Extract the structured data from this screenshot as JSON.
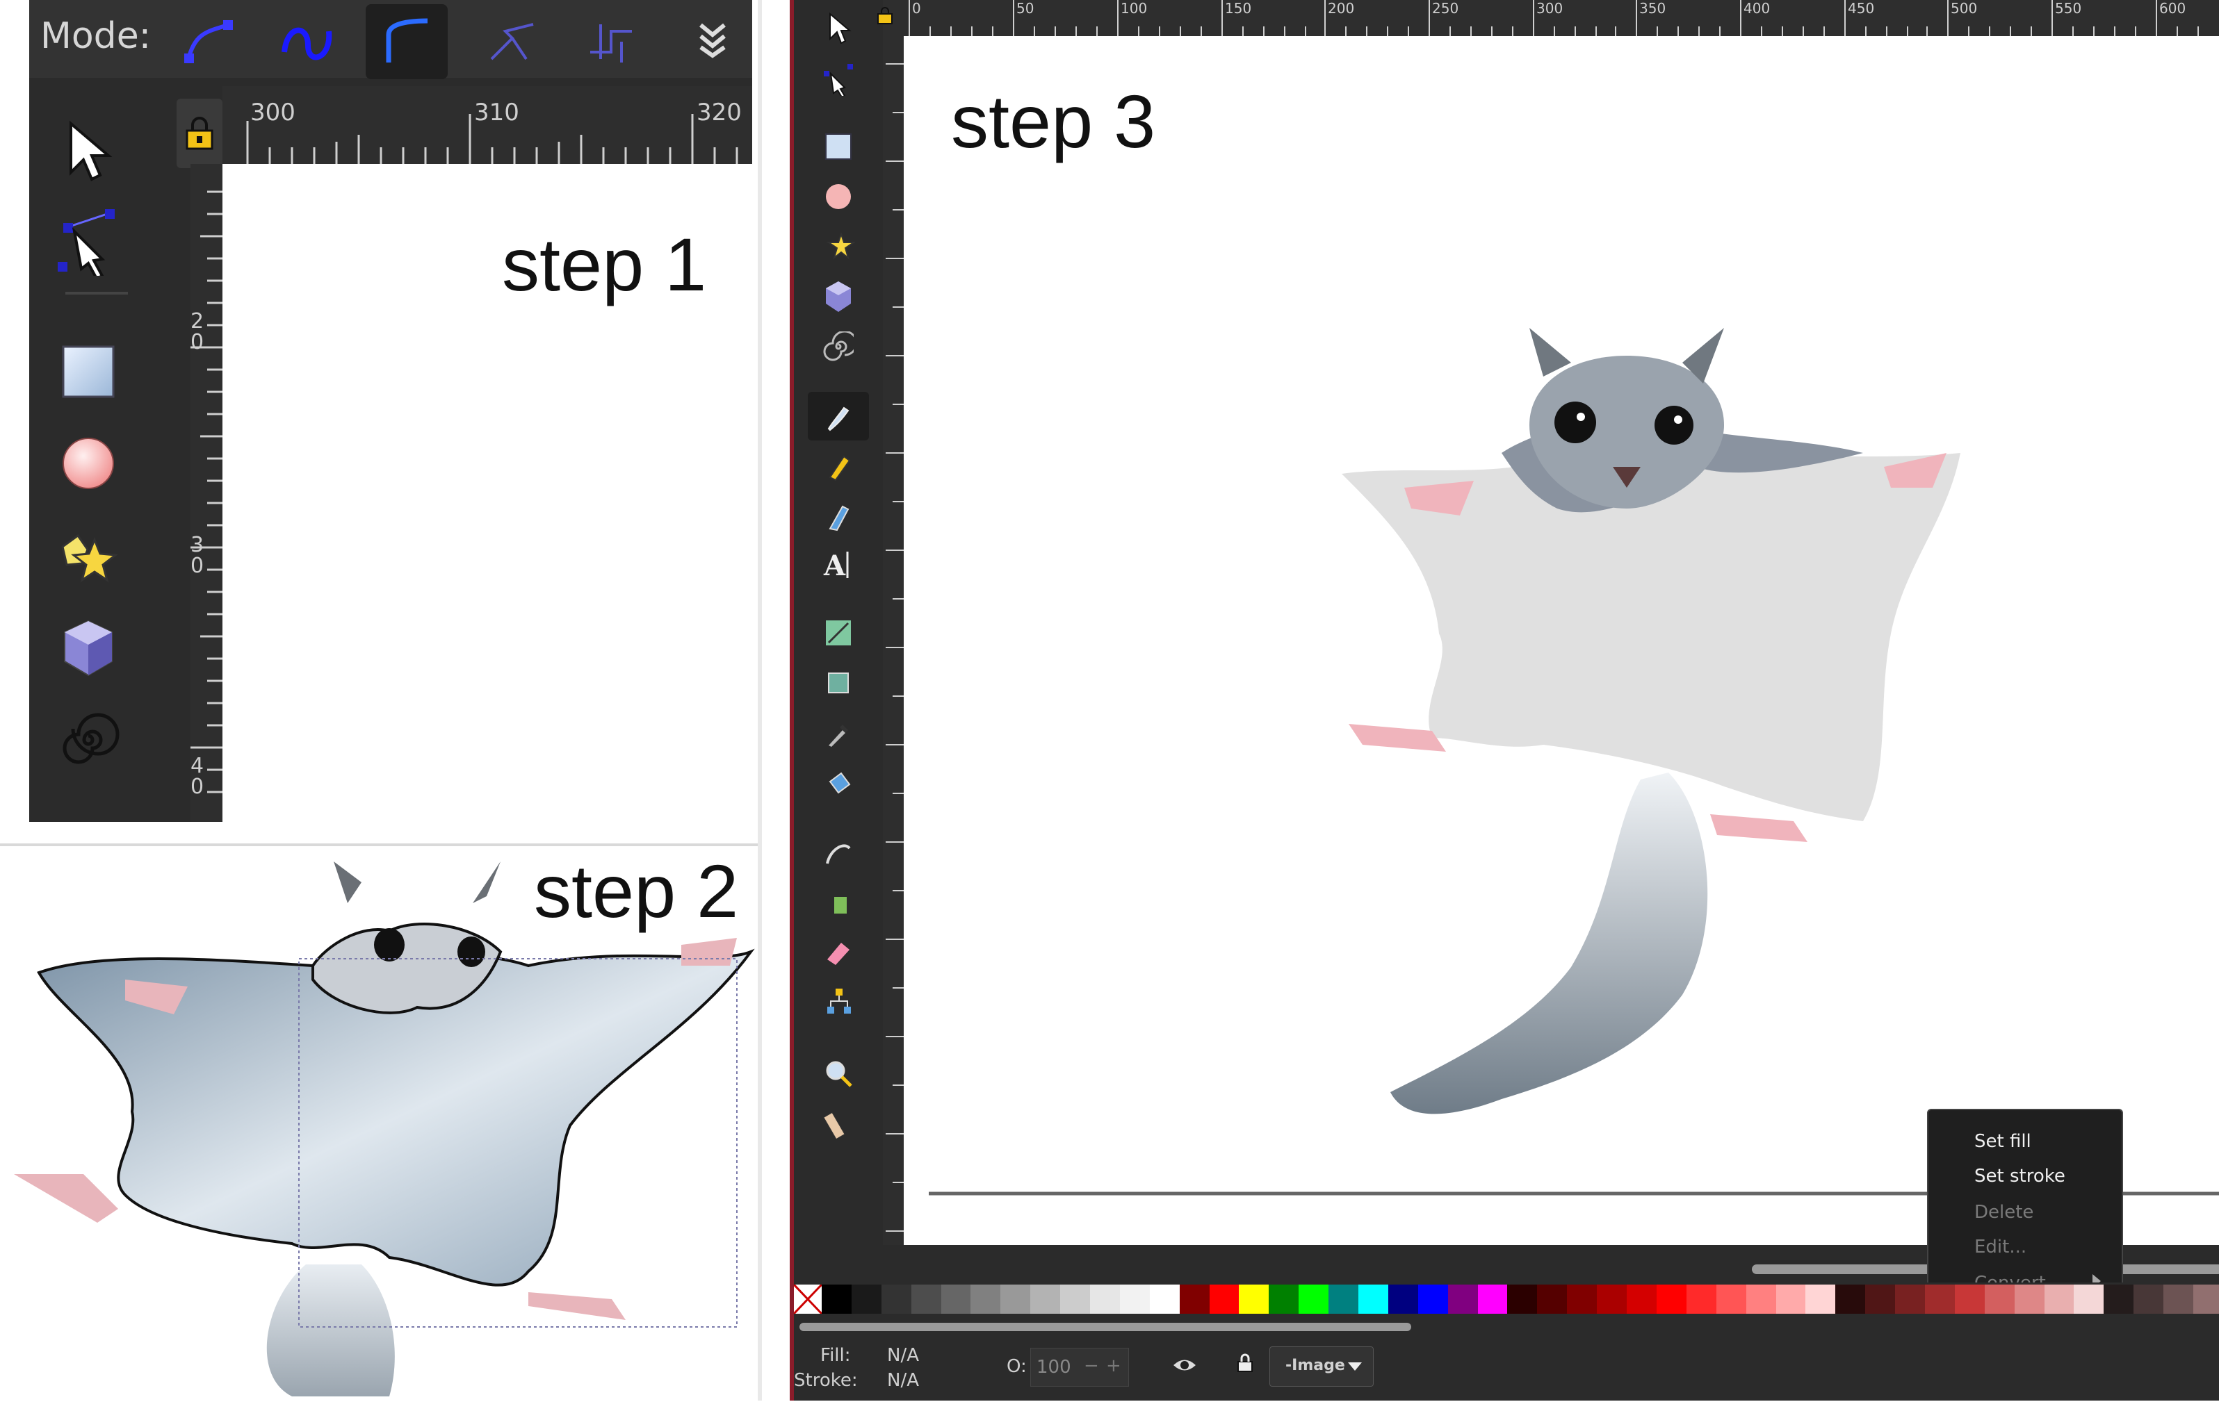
{
  "step_labels": {
    "step1": "step 1",
    "step2": "step 2",
    "step3": "step 3"
  },
  "panel1": {
    "mode_label": "Mode:",
    "mode_buttons": [
      "regular-bezier",
      "spiro",
      "bspline",
      "straight-segments",
      "paraxial-segments"
    ],
    "ruler_top": [
      "300",
      "310",
      "320"
    ],
    "ruler_left": [
      "2\n0",
      "3\n0",
      "4\n0"
    ],
    "tools": [
      "selector-icon",
      "node-icon",
      "rect-icon",
      "ellipse-icon",
      "star-icon",
      "3dbox-icon",
      "spiral-icon"
    ]
  },
  "panel3": {
    "ruler_top": [
      "0",
      "50",
      "100",
      "150",
      "200",
      "250",
      "300",
      "350",
      "400",
      "450",
      "500",
      "550",
      "600"
    ],
    "menu": {
      "items": [
        "Set fill",
        "Set stroke",
        "Delete",
        "Edit...",
        "Convert"
      ],
      "disabled": [
        false,
        false,
        true,
        true,
        true
      ]
    },
    "status": {
      "fill_label": "Fill:",
      "fill_value": "N/A",
      "stroke_label": "Stroke:",
      "stroke_value": "N/A",
      "opacity_label": "O:",
      "opacity_value": "100",
      "layer_button": "-Image"
    },
    "palette": [
      "#000000",
      "#1a1a1a",
      "#333333",
      "#4d4d4d",
      "#666666",
      "#808080",
      "#999999",
      "#b3b3b3",
      "#cccccc",
      "#e6e6e6",
      "#f2f2f2",
      "#ffffff",
      "#800000",
      "#ff0000",
      "#ffff00",
      "#008000",
      "#00ff00",
      "#008080",
      "#00ffff",
      "#000080",
      "#0000ff",
      "#800080",
      "#ff00ff",
      "#2b0000",
      "#550000",
      "#800000",
      "#aa0000",
      "#d40000",
      "#ff0000",
      "#ff2a2a",
      "#ff5555",
      "#ff8080",
      "#ffaaaa",
      "#ffd5d5",
      "#280b0b",
      "#501616",
      "#782121",
      "#a02c2c",
      "#c83737",
      "#d35f5f",
      "#de8787",
      "#e9afaf",
      "#f4d7d7",
      "#241c1c",
      "#483737",
      "#6c5353",
      "#916f6f"
    ]
  }
}
